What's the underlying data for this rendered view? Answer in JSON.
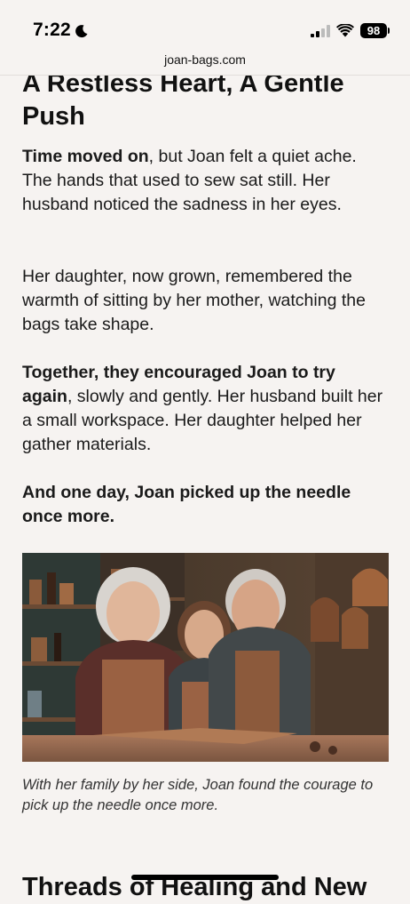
{
  "status_bar": {
    "time": "7:22",
    "battery": "98",
    "icons": [
      "moon-icon",
      "signal-icon",
      "wifi-icon",
      "battery-icon"
    ]
  },
  "browser": {
    "url": "joan-bags.com"
  },
  "article": {
    "heading_line1": "A Restless Heart, A Gentle",
    "heading_line2": "Push",
    "p1_bold": "Time moved on",
    "p1_rest": ", but Joan felt a quiet ache. The hands that used to sew sat still. Her husband noticed the sadness in her eyes.",
    "p2": "Her daughter, now grown, remembered the warmth of sitting by her mother, watching the bags take shape.",
    "p3_bold": "Together, they encouraged Joan to try again",
    "p3_rest": ", slowly and gently. Her husband built her a small workspace. Her daughter helped her gather materials.",
    "p4_bold": "And one day, Joan picked up the needle once more.",
    "photo_caption": "With her family by her side, Joan found the courage to pick up the needle once more.",
    "next_heading": "Threads of Healing and New"
  }
}
